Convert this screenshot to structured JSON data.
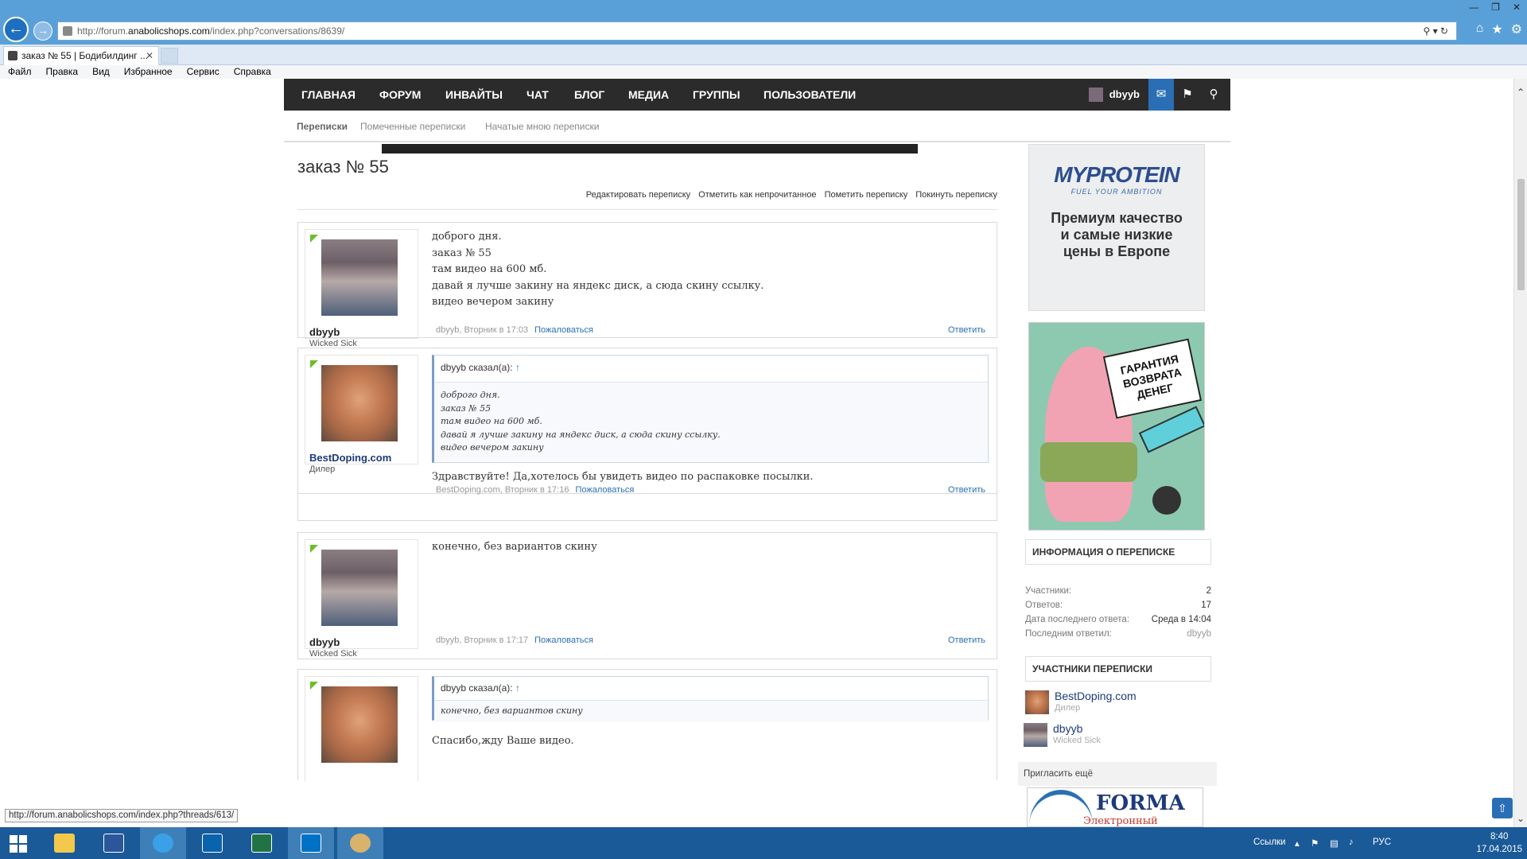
{
  "browser": {
    "url_prefix": "http://forum.",
    "url_domain": "anabolicshops.com",
    "url_path": "/index.php?conversations/8639/",
    "tab_title": "заказ № 55 | Бодибилдинг ...",
    "menu": [
      "Файл",
      "Правка",
      "Вид",
      "Избранное",
      "Сервис",
      "Справка"
    ]
  },
  "nav": {
    "items": [
      "ГЛАВНАЯ",
      "ФОРУМ",
      "ИНВАЙТЫ",
      "ЧАТ",
      "БЛОГ",
      "МЕДИА",
      "ГРУППЫ",
      "ПОЛЬЗОВАТЕЛИ"
    ],
    "username": "dbyyb"
  },
  "subnav": [
    "Переписки",
    "Помеченные переписки",
    "Начатые мною переписки"
  ],
  "page": {
    "title": "заказ № 55",
    "actions": [
      "Редактировать переписку",
      "Отметить как непрочитанное",
      "Пометить переписку",
      "Покинуть переписку"
    ]
  },
  "messages": [
    {
      "user": "dbyyb",
      "rank": "Wicked Sick",
      "lines": [
        "доброго дня.",
        "заказ № 55",
        "там видео на 600 мб.",
        "давай я лучше закину на яндекс диск, а сюда скину ссылку.",
        "видео вечером закину"
      ],
      "meta": "dbyyb, Вторник в 17:03",
      "complain": "Пожаловаться",
      "reply": "Ответить"
    },
    {
      "user": "BestDoping.com",
      "rank": "Дилер",
      "quote_head": "dbyyb сказал(а):",
      "quote_arrow": "↑",
      "quote_lines": [
        "доброго дня.",
        "заказ № 55",
        "там видео на 600 мб.",
        "давай я лучше закину на яндекс диск, а сюда скину ссылку.",
        "видео вечером закину"
      ],
      "text": "Здравствуйте! Да,хотелось бы увидеть видео по распаковке посылки.",
      "meta": "BestDoping.com, Вторник в 17:16",
      "complain": "Пожаловаться",
      "reply": "Ответить"
    },
    {
      "user": "dbyyb",
      "rank": "Wicked Sick",
      "text": "конечно, без вариантов скину",
      "meta": "dbyyb, Вторник в 17:17",
      "complain": "Пожаловаться",
      "reply": "Ответить"
    },
    {
      "quote_head": "dbyyb сказал(а):",
      "quote_arrow": "↑",
      "quote_lines": [
        "конечно, без вариантов скину"
      ],
      "text": "Спасибо,жду Ваше видео."
    }
  ],
  "sidebar": {
    "ad1_brand": "MYPROTEIN",
    "ad1_tag": "FUEL YOUR AMBITION",
    "ad1_text": [
      "Премиум качество",
      "и самые низкие",
      "цены в Европе"
    ],
    "ad2_sign": [
      "ГАРАНТИЯ",
      "ВОЗВРАТА",
      "ДЕНЕГ"
    ],
    "info_title": "ИНФОРМАЦИЯ О ПЕРЕПИСКЕ",
    "info": [
      {
        "k": "Участники:",
        "v": "2"
      },
      {
        "k": "Ответов:",
        "v": "17"
      },
      {
        "k": "Дата последнего ответа:",
        "v": "Среда в 14:04"
      },
      {
        "k": "Последним ответил:",
        "v": "dbyyb"
      }
    ],
    "participants_title": "УЧАСТНИКИ ПЕРЕПИСКИ",
    "participants": [
      {
        "name": "BestDoping.com",
        "rank": "Дилер"
      },
      {
        "name": "dbyyb",
        "rank": "Wicked Sick"
      }
    ],
    "invite": "Пригласить ещё",
    "ad3_title": "FORMA",
    "ad3_sub": "Электронный журнал"
  },
  "status_url": "http://forum.anabolicshops.com/index.php?threads/613/",
  "taskbar": {
    "links": "Ссылки",
    "lang": "РУС",
    "time": "8:40",
    "date": "17.04.2015"
  }
}
